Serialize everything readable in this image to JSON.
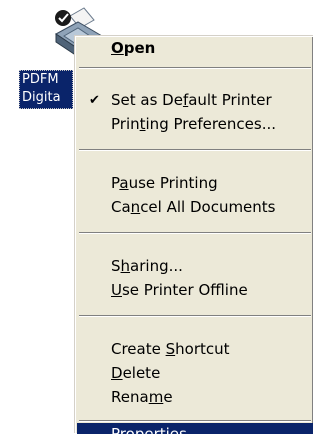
{
  "desktop_icon": {
    "icon": "printer-icon",
    "label_line1": "PDFM",
    "label_line2": "Digita"
  },
  "menu": {
    "open": {
      "pre": "",
      "key": "O",
      "post": "pen"
    },
    "set_default": {
      "pre": "Set as De",
      "key": "f",
      "post": "ault Printer",
      "checked": true,
      "check_icon": "check-icon"
    },
    "printing_prefs": {
      "pre": "Prin",
      "key": "t",
      "post": "ing Preferences..."
    },
    "pause_printing": {
      "pre": "P",
      "key": "a",
      "post": "use Printing"
    },
    "cancel_all": {
      "pre": "Ca",
      "key": "n",
      "post": "cel All Documents"
    },
    "sharing": {
      "pre": "S",
      "key": "h",
      "post": "aring..."
    },
    "use_offline": {
      "pre": "",
      "key": "U",
      "post": "se Printer Offline"
    },
    "create_shortcut": {
      "pre": "Create ",
      "key": "S",
      "post": "hortcut"
    },
    "delete": {
      "pre": "",
      "key": "D",
      "post": "elete"
    },
    "rename": {
      "pre": "Rena",
      "key": "m",
      "post": "e"
    },
    "properties": {
      "pre": "P",
      "key": "r",
      "post": "operties"
    }
  },
  "colors": {
    "selection": "#0a246a",
    "menu_bg": "#ece9d8"
  }
}
